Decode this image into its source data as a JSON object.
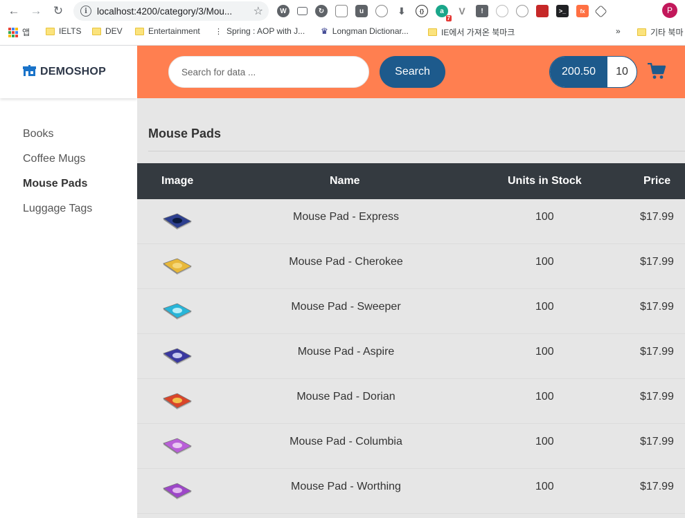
{
  "browser": {
    "url": "localhost:4200/category/3/Mou...",
    "profile_initial": "P",
    "bookmarks": [
      {
        "label": "앱"
      },
      {
        "label": "IELTS"
      },
      {
        "label": "DEV"
      },
      {
        "label": "Entertainment"
      },
      {
        "label": "Spring : AOP with J..."
      },
      {
        "label": "Longman Dictionar..."
      },
      {
        "label": "IE에서 가져온 북마크"
      },
      {
        "label": "기타 북마"
      }
    ],
    "overflow_label": "»",
    "extension_badge": "7"
  },
  "brand": {
    "name": "DEMOSHOP",
    "icon": "shop-icon"
  },
  "categories": [
    {
      "label": "Books",
      "active": false
    },
    {
      "label": "Coffee Mugs",
      "active": false
    },
    {
      "label": "Mouse Pads",
      "active": true
    },
    {
      "label": "Luggage Tags",
      "active": false
    }
  ],
  "header": {
    "search_placeholder": "Search for data ...",
    "search_button": "Search",
    "cart_total": "200.50",
    "cart_quantity": "10",
    "cart_icon": "shopping-cart-icon",
    "accent_color": "#ff7f50",
    "button_color": "#1d5a8c"
  },
  "main": {
    "title": "Mouse Pads",
    "columns": [
      "Image",
      "Name",
      "Units in Stock",
      "Price"
    ],
    "products": [
      {
        "name": "Mouse Pad - Express",
        "stock": "100",
        "price": "$17.99",
        "color": "#2d3f8f",
        "accent": "#0b1a3e"
      },
      {
        "name": "Mouse Pad - Cherokee",
        "stock": "100",
        "price": "$17.99",
        "color": "#e8b83a",
        "accent": "#f5d77a"
      },
      {
        "name": "Mouse Pad - Sweeper",
        "stock": "100",
        "price": "$17.99",
        "color": "#28b5d8",
        "accent": "#b8eef7"
      },
      {
        "name": "Mouse Pad - Aspire",
        "stock": "100",
        "price": "$17.99",
        "color": "#3a38a0",
        "accent": "#c7c8f0"
      },
      {
        "name": "Mouse Pad - Dorian",
        "stock": "100",
        "price": "$17.99",
        "color": "#d9452a",
        "accent": "#f2c04a"
      },
      {
        "name": "Mouse Pad - Columbia",
        "stock": "100",
        "price": "$17.99",
        "color": "#b95fd8",
        "accent": "#e9c8f2"
      },
      {
        "name": "Mouse Pad - Worthing",
        "stock": "100",
        "price": "$17.99",
        "color": "#9d47c8",
        "accent": "#e1b9ee"
      }
    ]
  }
}
